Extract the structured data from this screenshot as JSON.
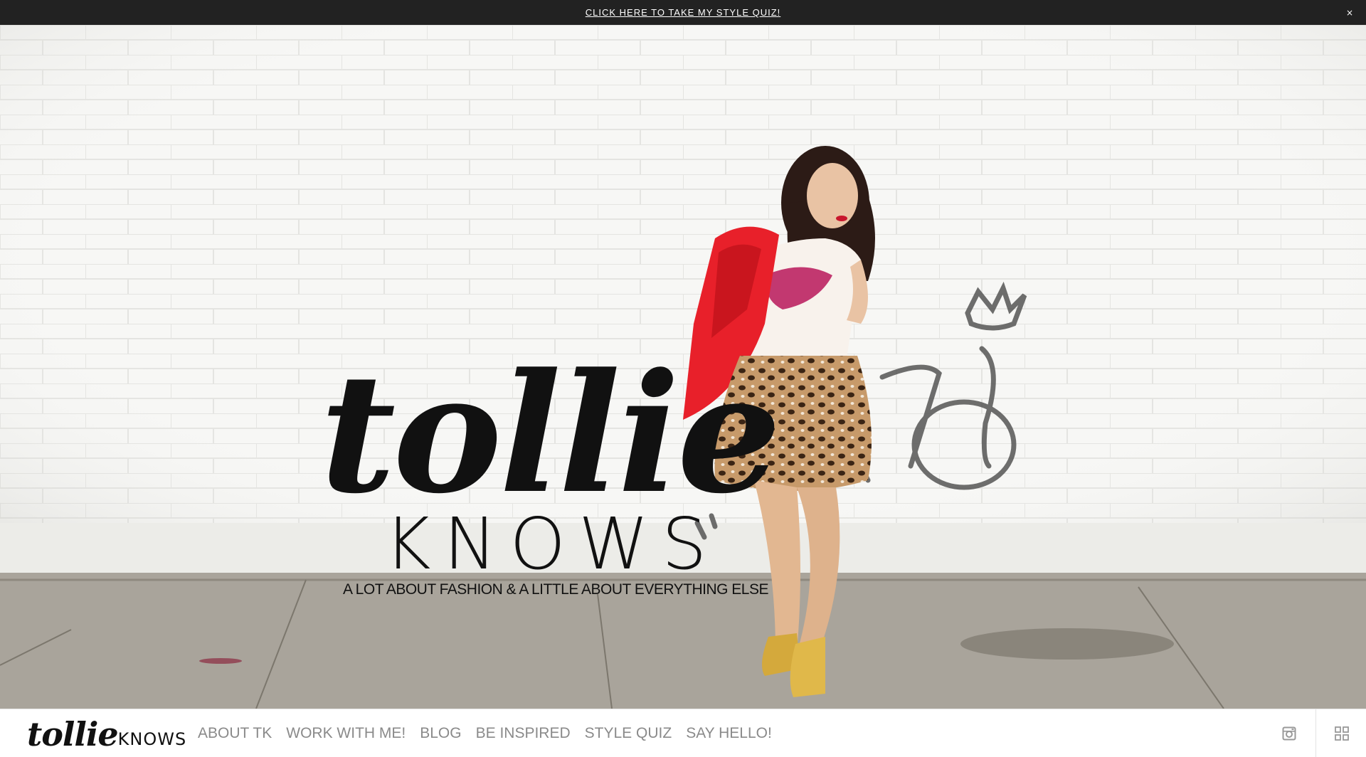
{
  "announcement": {
    "text": "CLICK HERE TO TAKE MY STYLE QUIZ!",
    "close": "×"
  },
  "hero": {
    "logo_script": "tollie",
    "logo_knows": "KNOWS",
    "tagline": "A LOT ABOUT FASHION & A LITTLE ABOUT EVERYTHING ELSE"
  },
  "nav": {
    "brand_script": "tollie",
    "brand_knows": "KNOWS",
    "items": [
      {
        "label": "ABOUT TK"
      },
      {
        "label": "WORK WITH ME!"
      },
      {
        "label": "BLOG"
      },
      {
        "label": "BE INSPIRED"
      },
      {
        "label": "STYLE QUIZ"
      },
      {
        "label": "SAY HELLO!"
      }
    ],
    "icons": [
      "instagram-icon",
      "grid-menu-icon"
    ]
  },
  "colors": {
    "bar": "#222222",
    "nav_text": "#8a8a8a",
    "jacket": "#e8202a",
    "shoes": "#d4a93c"
  }
}
